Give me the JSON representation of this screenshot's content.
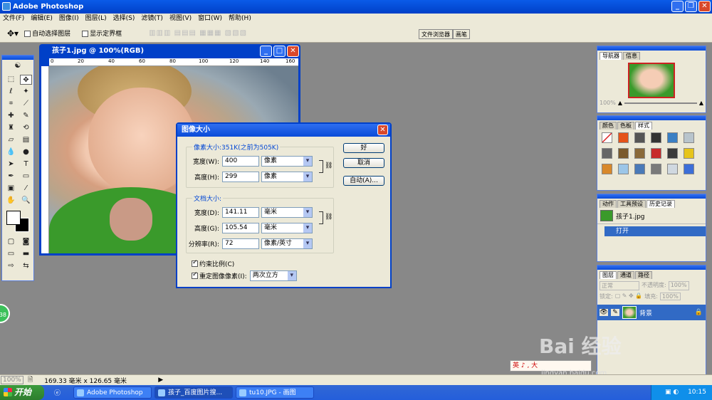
{
  "app": {
    "title": "Adobe Photoshop"
  },
  "menu": [
    "文件(F)",
    "编辑(E)",
    "图像(I)",
    "图层(L)",
    "选择(S)",
    "滤镜(T)",
    "视图(V)",
    "窗口(W)",
    "帮助(H)"
  ],
  "options": {
    "auto_select": "自动选择图层",
    "show_bounds": "显示定界框",
    "well_tabs": [
      "文件浏览器",
      "画笔"
    ]
  },
  "document": {
    "title": "孩子1.jpg @ 100%(RGB)",
    "ruler_ticks": [
      "0",
      "20",
      "40",
      "60",
      "80",
      "100",
      "120",
      "140",
      "160"
    ]
  },
  "dialog": {
    "title": "图像大小",
    "pixel_dims": {
      "label": "像素大小:351K(之前为505K)",
      "width_label": "宽度(W):",
      "width": "400",
      "width_unit": "像素",
      "height_label": "高度(H):",
      "height": "299",
      "height_unit": "像素"
    },
    "doc_size": {
      "label": "文档大小:",
      "width_label": "宽度(D):",
      "width": "141.11",
      "width_unit": "毫米",
      "height_label": "高度(G):",
      "height": "105.54",
      "height_unit": "毫米",
      "res_label": "分辨率(R):",
      "res": "72",
      "res_unit": "像素/英寸"
    },
    "constrain": "约束比例(C)",
    "resample": "重定图像像素(I):",
    "resample_method": "两次立方",
    "ok": "好",
    "cancel": "取消",
    "auto": "自动(A)..."
  },
  "panels": {
    "nav_tabs": [
      "导航器",
      "信息"
    ],
    "nav_zoom": "100%",
    "color_tabs": [
      "颜色",
      "色板",
      "样式"
    ],
    "history_tabs": [
      "动作",
      "工具预设",
      "历史记录"
    ],
    "history_items": [
      "孩子1.jpg",
      "打开"
    ],
    "layer_tabs": [
      "图层",
      "通道",
      "路径"
    ],
    "layer_mode": "正常",
    "opacity_label": "不透明度:",
    "opacity": "100%",
    "lock_label": "锁定:",
    "fill_label": "填充:",
    "fill": "100%",
    "layer_name": "背景"
  },
  "status": {
    "zoom": "100%",
    "size": "169.33 毫米 x 126.65 毫米"
  },
  "taskbar": {
    "start": "开始",
    "tasks": [
      "Adobe Photoshop",
      "孩子_百度图片搜...",
      "tu10.JPG - 画图"
    ],
    "clock": "10:15"
  },
  "watermark": {
    "brand": "Bai 经验",
    "url": "jingyan.baidu.com"
  },
  "ime": "英 ♪ , 大",
  "badge": "38",
  "colors": {
    "xp_blue": "#0040c8",
    "dialog_bg": "#ece9d8"
  }
}
